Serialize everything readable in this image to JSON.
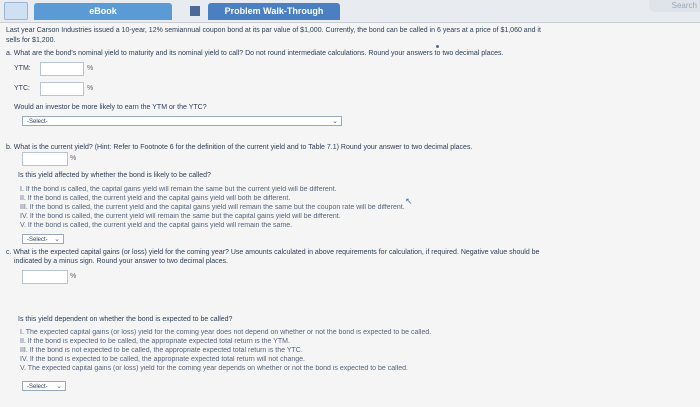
{
  "tabs": {
    "ebook": "eBook",
    "walkthrough": "Problem Walk-Through",
    "search": "Search"
  },
  "intro": {
    "line1": "Last year Carson Industries issued a 10-year, 12% semiannual coupon bond at its par value of $1,000. Currently, the bond can be called in 6 years at a price of $1,060 and it",
    "line2": "sells for $1,200."
  },
  "part_a": {
    "question": "a. What are the bond's nominal yield to maturity and its nominal yield to call? Do not round intermediate calculations. Round your answers to two decimal places.",
    "ytm_label": "YTM:",
    "ytc_label": "YTC:",
    "unit": "%",
    "investor_q": "Would an investor be more likely to earn the YTM or the YTC?",
    "select_value": "-Select-"
  },
  "part_b": {
    "question": "b. What is the current yield? (Hint: Refer to Footnote 6 for the definition of the current yield and to Table 7.1) Round your answer to two decimal places.",
    "unit": "%",
    "affected_q": "Is this yield affected by whether the bond is likely to be called?",
    "options": [
      "I. If the bond is called, the capital gains yield will remain the same but the current yield will be different.",
      "II. If the bond is called, the current yield and the capital gains yield will both be different.",
      "III. If the bond is called, the current yield and the capital gains yield will remain the same but the coupon rate will be different.",
      "IV. If the bond is called, the current yield will remain the same but the capital gains yield will be different.",
      "V. If the bond is called, the current yield and the capital gains yield will remain the same."
    ],
    "select_value": "-Select-"
  },
  "part_c": {
    "question_line1": "c. What is the expected capital gains (or loss) yield for the coming year? Use amounts calculated in above requirements for calculation, if required. Negative value should be",
    "question_line2": "indicated by a minus sign. Round your answer to two decimal places.",
    "unit": "%",
    "dependent_q": "Is this yield dependent on whether the bond is expected to be called?",
    "options": [
      "I. The expected capital gains (or loss) yield for the coming year does not depend on whether or not the bond is expected to be called.",
      "II. If the bond is expected to be called, the appropriate expected total return is the YTM.",
      "III. If the bond is not expected to be called, the appropriate expected total return is the YTC.",
      "IV. If the bond is expected to be called, the appropriate expected total return will not change.",
      "V. The expected capital gains (or loss) yield for the coming year depends on whether or not the bond is expected to be called."
    ],
    "select_value": "-Select-"
  }
}
